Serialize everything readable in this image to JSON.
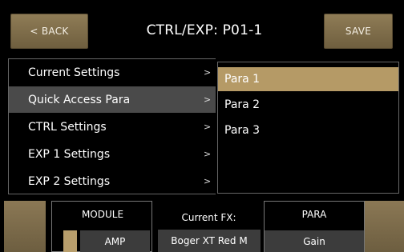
{
  "header": {
    "back_label": "< BACK",
    "title": "CTRL/EXP: P01-1",
    "save_label": "SAVE"
  },
  "menu": {
    "items": [
      {
        "label": "Current Settings",
        "chevron": ">"
      },
      {
        "label": "Quick Access Para",
        "chevron": ">",
        "selected": true
      },
      {
        "label": "CTRL Settings",
        "chevron": ">"
      },
      {
        "label": "EXP 1 Settings",
        "chevron": ">"
      },
      {
        "label": "EXP 2 Settings",
        "chevron": ">"
      }
    ]
  },
  "para_list": {
    "items": [
      {
        "label": "Para 1",
        "selected": true
      },
      {
        "label": "Para 2"
      },
      {
        "label": "Para 3"
      }
    ]
  },
  "bottom": {
    "module_label": "MODULE",
    "module_value": "AMP",
    "fx_label": "Current FX:",
    "fx_value": "Boger XT Red M",
    "para_label": "PARA",
    "para_value": "Gain"
  },
  "colors": {
    "accent_gold": "#b59a66",
    "button_brown": "#7f6c49",
    "selected_gray": "#4a4a4a"
  }
}
